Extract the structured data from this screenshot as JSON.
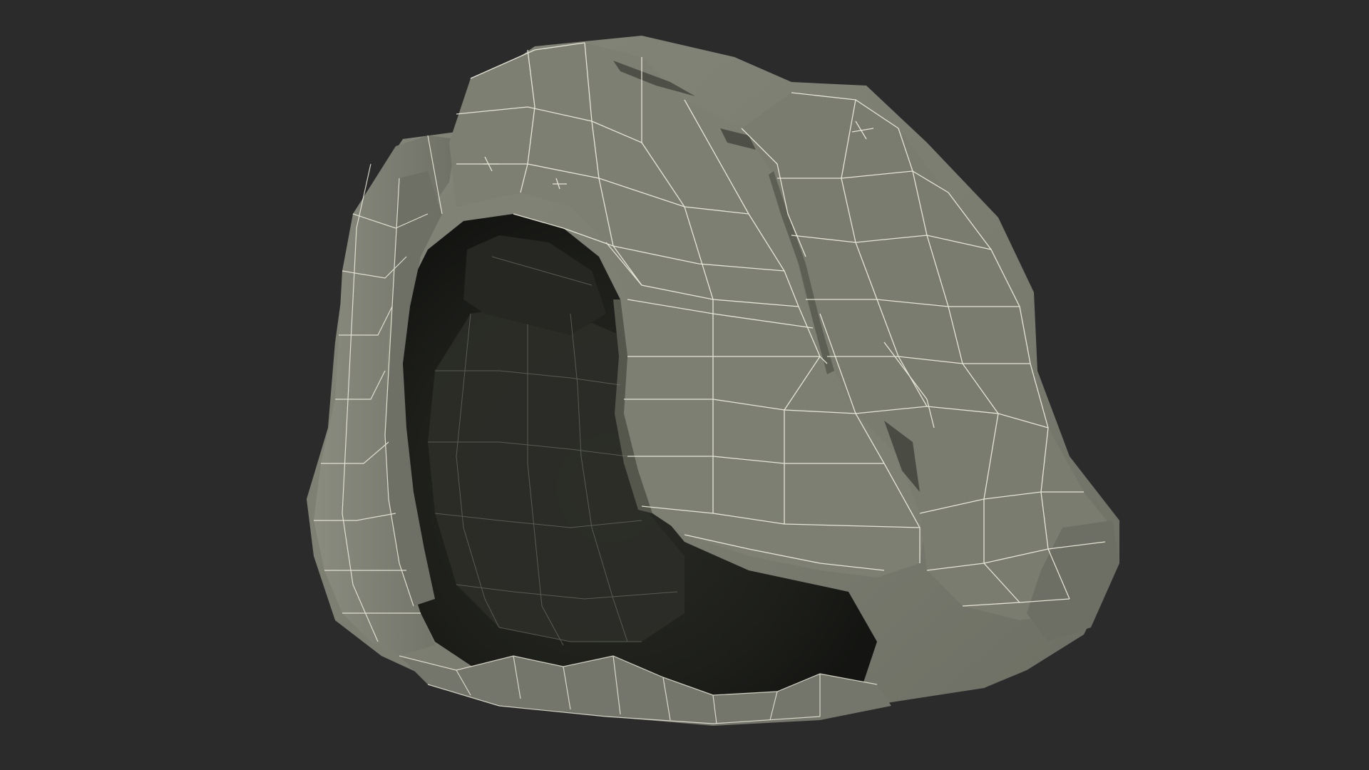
{
  "scene": {
    "subject": "wireframe-hair-mesh",
    "colors": {
      "background": "#2b2b2b",
      "mesh_surface": "#7b7d72",
      "mesh_surface_light": "#8a8c80",
      "mesh_shadow": "#5f6157",
      "interior_dark": "#20211d",
      "interior_mid": "#2f302b",
      "wire_lines": "#f2efdf",
      "wire_lines_dim": "#777a70"
    }
  }
}
